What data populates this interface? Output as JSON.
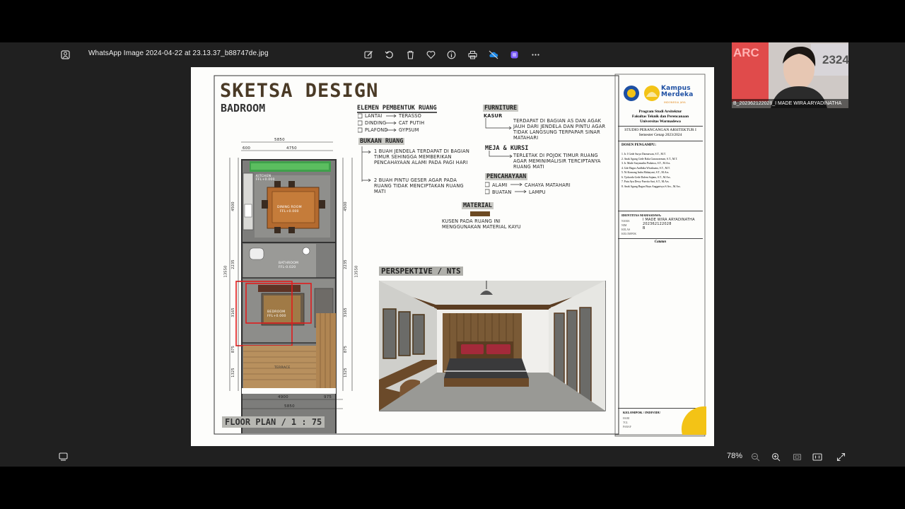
{
  "viewer": {
    "file_name": "WhatsApp Image 2024-04-22 at 23.13.37_b88747de.jpg",
    "zoom": "78%",
    "toolbar_icons": [
      "edit-icon",
      "rotate-icon",
      "delete-icon",
      "heart-icon",
      "info-icon",
      "print-icon",
      "cloud-icon",
      "app-icon",
      "more-icon"
    ],
    "bottom_icons": [
      "filmstrip-icon",
      "zoom-out-icon",
      "zoom-in-icon",
      "fit-icon",
      "actual-size-icon",
      "fullscreen-icon"
    ]
  },
  "webcam": {
    "participant_label": "B_202362122028_I MADE WIRA ARYADINATHA",
    "background_text_left": "ARC",
    "background_text_right": "2324"
  },
  "sheet": {
    "title": "SKETSA DESIGN",
    "subtitle": "BADROOM",
    "floor_plan_label": "FLOOR PLAN / 1 : 75",
    "perspective_label": "PERSPEKTIVE / NTS",
    "plan_rooms": {
      "kitchen": "KITCHEN\nFFL+0.000",
      "dining": "DINING ROOM\nFFL+0.000",
      "bathroom": "BATHROOM\nFFL-0.020",
      "bedroom": "BEDROOM\nFFL+0.000",
      "terrace": "TERRACE"
    },
    "plan_dims": {
      "top_outer": "5850",
      "top_left": "600",
      "top_inner": "4750",
      "bottom_outer": "5850",
      "bottom_left": "4900",
      "bottom_right": "975",
      "left_total": "13550",
      "left_1": "4500",
      "left_2": "2235",
      "left_3": "3165",
      "left_4": "875",
      "left_5": "1325",
      "right_total": "13550",
      "right_1": "4500",
      "right_2": "2235",
      "right_3": "3165",
      "right_4": "875",
      "right_5": "1325"
    },
    "elements": {
      "heading": "ELEMEN PEMBENTUK RUANG",
      "items": [
        {
          "label": "LANTAI",
          "value": "TERASSO"
        },
        {
          "label": "DINDING",
          "value": "CAT PUTIH"
        },
        {
          "label": "PLAFOND",
          "value": "GYPSUM"
        }
      ]
    },
    "openings": {
      "heading": "BUKAAN RUANG",
      "item1": "1 BUAH JENDELA TERDAPAT DI BAGIAN TIMUR SEHINGGA MEMBERIKAN PENCAHAYAAN ALAMI PADA PAGI HARI",
      "item2": "2 BUAH PINTU GESER AGAR PADA RUANG TIDAK MENCIPTAKAN RUANG MATI"
    },
    "furniture": {
      "heading": "FURNITURE",
      "kasur_label": "KASUR",
      "kasur_text": "TERDAPAT DI BAGIAN AS DAN AGAK JAUH DARI JENDELA DAN PINTU AGAR TIDAK LANGSUNG TERPAPAR SINAR MATAHARI",
      "meja_label": "MEJA & KURSI",
      "meja_text": "TERLETAK DI POJOK TIMUR RUANG AGAR MEMINIMALISIR TERCIPTANYA RUANG MATI"
    },
    "lighting": {
      "heading": "PENCAHAYAAN",
      "items": [
        {
          "label": "ALAMI",
          "value": "CAHAYA MATAHARI"
        },
        {
          "label": "BUATAN",
          "value": "LAMPU"
        }
      ]
    },
    "material": {
      "heading": "MATERIAL",
      "text": "KUSEN PADA RUANG INI MENGGUNAKAN MATERIAL KAYU"
    },
    "title_block": {
      "logo_text": "Kampus Merdeka",
      "logo_subtext": "INDONESIA JAYA",
      "program": "Program Studi Arsitektur",
      "faculty": "Fakultas Teknik dan Perencanaan",
      "university": "Universitas Warmadewa",
      "studio": "STUDIO PERANCANGAN ARSITEKTUR I",
      "semester": "Semester Genap 2023/2024",
      "lecturers_heading": "DOSEN PENGAMPU:",
      "lecturers": [
        "1. Ir. I Gede Surya Darmawan, S.T., M.T.",
        "2. Anak Agung Gede Raka Gunawarman, S.T., M.T.",
        "3. Ir. Made Suryanatha Prabawa, S.T., M.Ars.",
        "4. Gde Bagus Andhika Wicaksana, S.T., M.T.",
        "5. Ni Komang Indra Mahayani, S.T., M.Ars.",
        "6. Tjokorda Gede Dalem Sujana, S.T., M.Ars.",
        "7. Putu Ayu Dewy Pusvita Sari, S.T., M.Ars.",
        "8. Anak Agung Bagus Bayu Anggarisya S.Ars., M.Ars."
      ],
      "identity_heading": "IDENTITAS MAHASISWA:",
      "identity_labels": [
        "NAMA",
        "NIM",
        "KELAS",
        "KELOMPOK"
      ],
      "identity_values": [
        "I MADE WIRA ARYADINATHA",
        "202362122028",
        "B",
        ""
      ],
      "catatan": "Catatan",
      "group_heading": "KELOMPOK / INDIVIDU",
      "group_labels": [
        "HARI",
        "TGL",
        "PARAF"
      ]
    }
  }
}
